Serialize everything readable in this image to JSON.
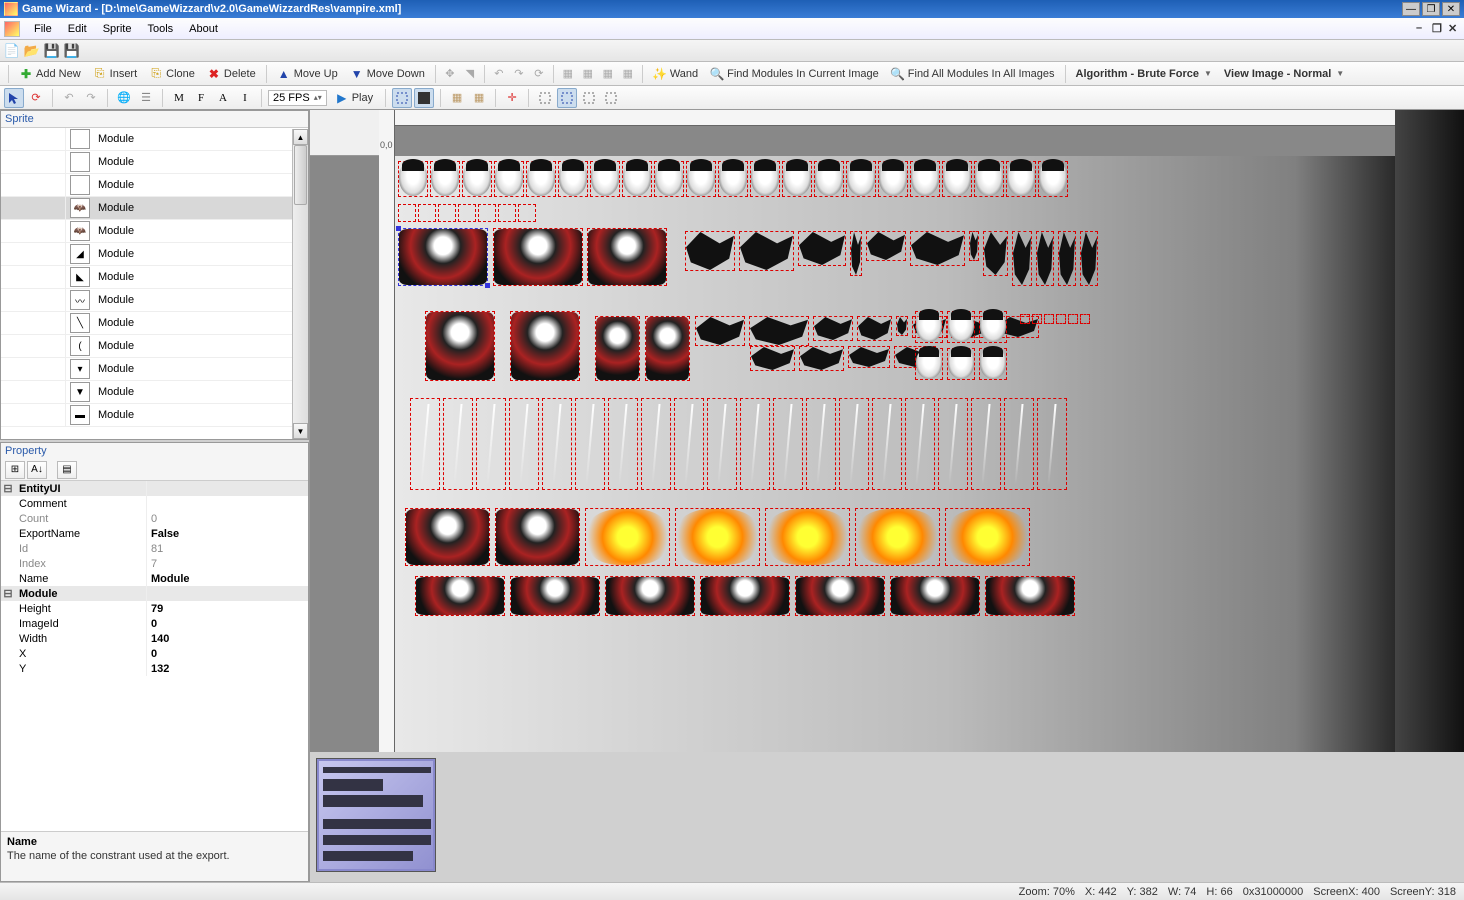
{
  "window": {
    "title": "Game Wizard - [D:\\me\\GameWizzard\\v2.0\\GameWizzardRes\\vampire.xml]"
  },
  "menu": {
    "items": [
      "File",
      "Edit",
      "Sprite",
      "Tools",
      "About"
    ]
  },
  "action_toolbar": {
    "add_new": "Add New",
    "insert": "Insert",
    "clone": "Clone",
    "delete": "Delete",
    "move_up": "Move Up",
    "move_down": "Move Down",
    "wand": "Wand",
    "find_modules_current": "Find Modules In Current Image",
    "find_all_modules": "Find All Modules In All Images",
    "algorithm": "Algorithm - Brute Force",
    "view_image": "View Image - Normal"
  },
  "edit_toolbar": {
    "m": "M",
    "f": "F",
    "a": "A",
    "i": "I",
    "fps": "25 FPS",
    "play": "Play"
  },
  "sprite_panel": {
    "title": "Sprite",
    "items": [
      {
        "glyph": "",
        "label": "Module",
        "selected": false
      },
      {
        "glyph": "",
        "label": "Module",
        "selected": false
      },
      {
        "glyph": "",
        "label": "Module",
        "selected": false
      },
      {
        "glyph": "🦇",
        "label": "Module",
        "selected": true
      },
      {
        "glyph": "🦇",
        "label": "Module",
        "selected": false
      },
      {
        "glyph": "◢",
        "label": "Module",
        "selected": false
      },
      {
        "glyph": "◣",
        "label": "Module",
        "selected": false
      },
      {
        "glyph": "〰",
        "label": "Module",
        "selected": false
      },
      {
        "glyph": "╲",
        "label": "Module",
        "selected": false
      },
      {
        "glyph": "(",
        "label": "Module",
        "selected": false
      },
      {
        "glyph": "▾",
        "label": "Module",
        "selected": false
      },
      {
        "glyph": "▼",
        "label": "Module",
        "selected": false
      },
      {
        "glyph": "▬",
        "label": "Module",
        "selected": false
      }
    ]
  },
  "property_panel": {
    "title": "Property",
    "groups": [
      {
        "name": "EntityUI",
        "rows": [
          {
            "key": "Comment",
            "val": "",
            "editable": true
          },
          {
            "key": "Count",
            "val": "0",
            "editable": false
          },
          {
            "key": "ExportName",
            "val": "False",
            "editable": true
          },
          {
            "key": "Id",
            "val": "81",
            "editable": false
          },
          {
            "key": "Index",
            "val": "7",
            "editable": false
          },
          {
            "key": "Name",
            "val": "Module",
            "editable": true
          }
        ]
      },
      {
        "name": "Module",
        "rows": [
          {
            "key": "Height",
            "val": "79",
            "editable": true
          },
          {
            "key": "ImageId",
            "val": "0",
            "editable": true
          },
          {
            "key": "Width",
            "val": "140",
            "editable": true
          },
          {
            "key": "X",
            "val": "0",
            "editable": true
          },
          {
            "key": "Y",
            "val": "132",
            "editable": true
          }
        ]
      }
    ],
    "desc": {
      "name": "Name",
      "text": "The name of the constrant used at the export."
    }
  },
  "canvas": {
    "origin_label": "0,0"
  },
  "status": {
    "zoom": "Zoom: 70%",
    "x": "X: 442",
    "y": "Y: 382",
    "w": "W: 74",
    "h": "H: 66",
    "hex": "0x31000000",
    "sx": "ScreenX: 400",
    "sy": "ScreenY: 318"
  }
}
